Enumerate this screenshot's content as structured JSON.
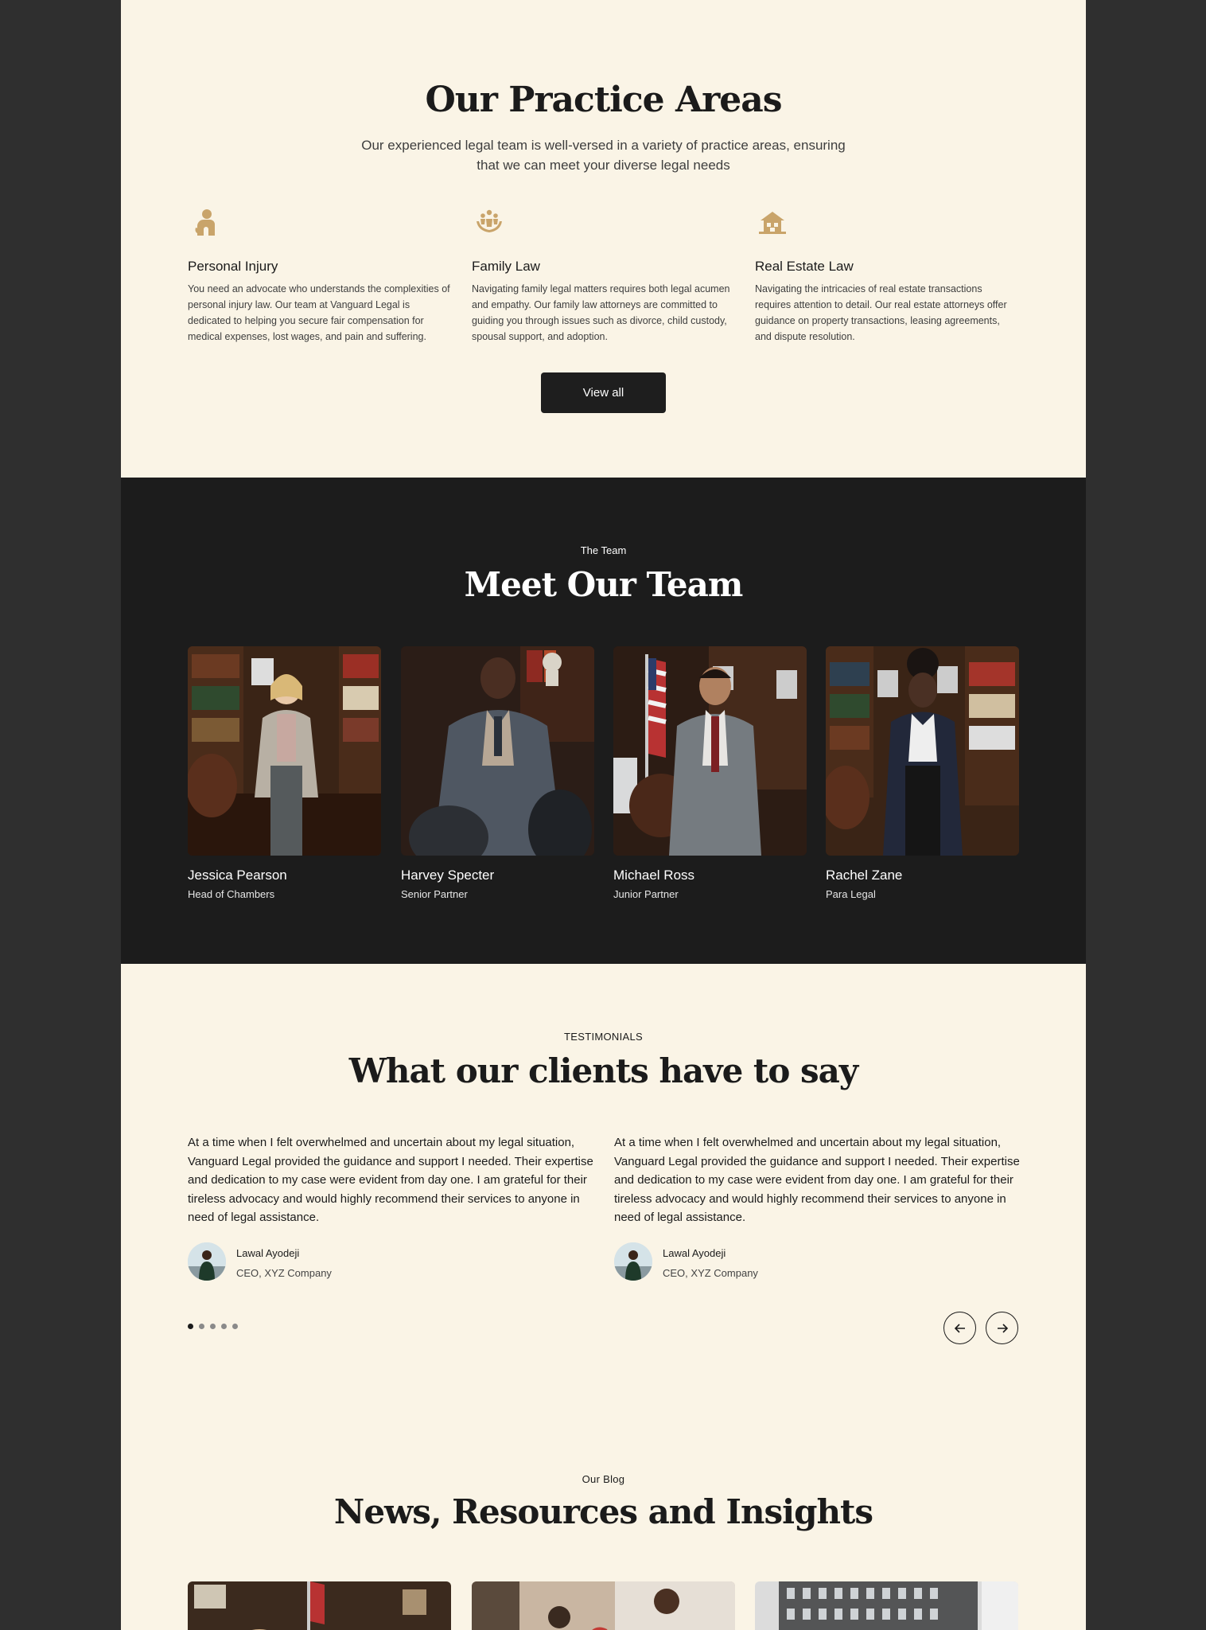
{
  "practice": {
    "title": "Our Practice Areas",
    "subtitle": "Our experienced legal team is well-versed in a variety of practice areas, ensuring that we can meet your diverse legal needs",
    "areas": [
      {
        "icon": "person-injury-icon",
        "title": "Personal Injury",
        "text": "You need an advocate who understands the complexities of personal injury law. Our team at Vanguard Legal is dedicated to helping you secure fair compensation for medical expenses, lost wages, and pain and suffering."
      },
      {
        "icon": "family-icon",
        "title": "Family Law",
        "text": "Navigating family legal matters requires both legal acumen and empathy. Our family law attorneys are committed to guiding you through issues such as divorce, child custody, spousal support, and adoption."
      },
      {
        "icon": "house-icon",
        "title": "Real Estate Law",
        "text": "Navigating the intricacies of real estate transactions requires attention to detail. Our real estate attorneys offer guidance on property transactions, leasing agreements, and dispute resolution."
      }
    ],
    "button": "View all",
    "icon_color": "#c9a46a"
  },
  "team": {
    "eyebrow": "The Team",
    "title": "Meet Our Team",
    "members": [
      {
        "name": "Jessica Pearson",
        "role": "Head of Chambers"
      },
      {
        "name": "Harvey Specter",
        "role": "Senior Partner"
      },
      {
        "name": "Michael Ross",
        "role": "Junior Partner"
      },
      {
        "name": "Rachel Zane",
        "role": "Para Legal"
      }
    ]
  },
  "testimonials": {
    "eyebrow": "TESTIMONIALS",
    "title": "What our clients have to say",
    "items": [
      {
        "quote": "At a time when I felt overwhelmed and uncertain about my legal situation, Vanguard Legal provided the guidance and support I needed. Their expertise and dedication to my case were evident from day one. I am grateful for their tireless advocacy and would highly recommend their services to anyone in need of legal assistance.",
        "name": "Lawal Ayodeji",
        "role": "CEO, XYZ Company"
      },
      {
        "quote": "At a time when I felt overwhelmed and uncertain about my legal situation, Vanguard Legal provided the guidance and support I needed. Their expertise and dedication to my case were evident from day one. I am grateful for their tireless advocacy and would highly recommend their services to anyone in need of legal assistance.",
        "name": "Lawal Ayodeji",
        "role": "CEO, XYZ Company"
      }
    ],
    "active_page": 1,
    "total_pages": 5
  },
  "blog": {
    "eyebrow": "Our Blog",
    "title": "News, Resources and Insights"
  }
}
